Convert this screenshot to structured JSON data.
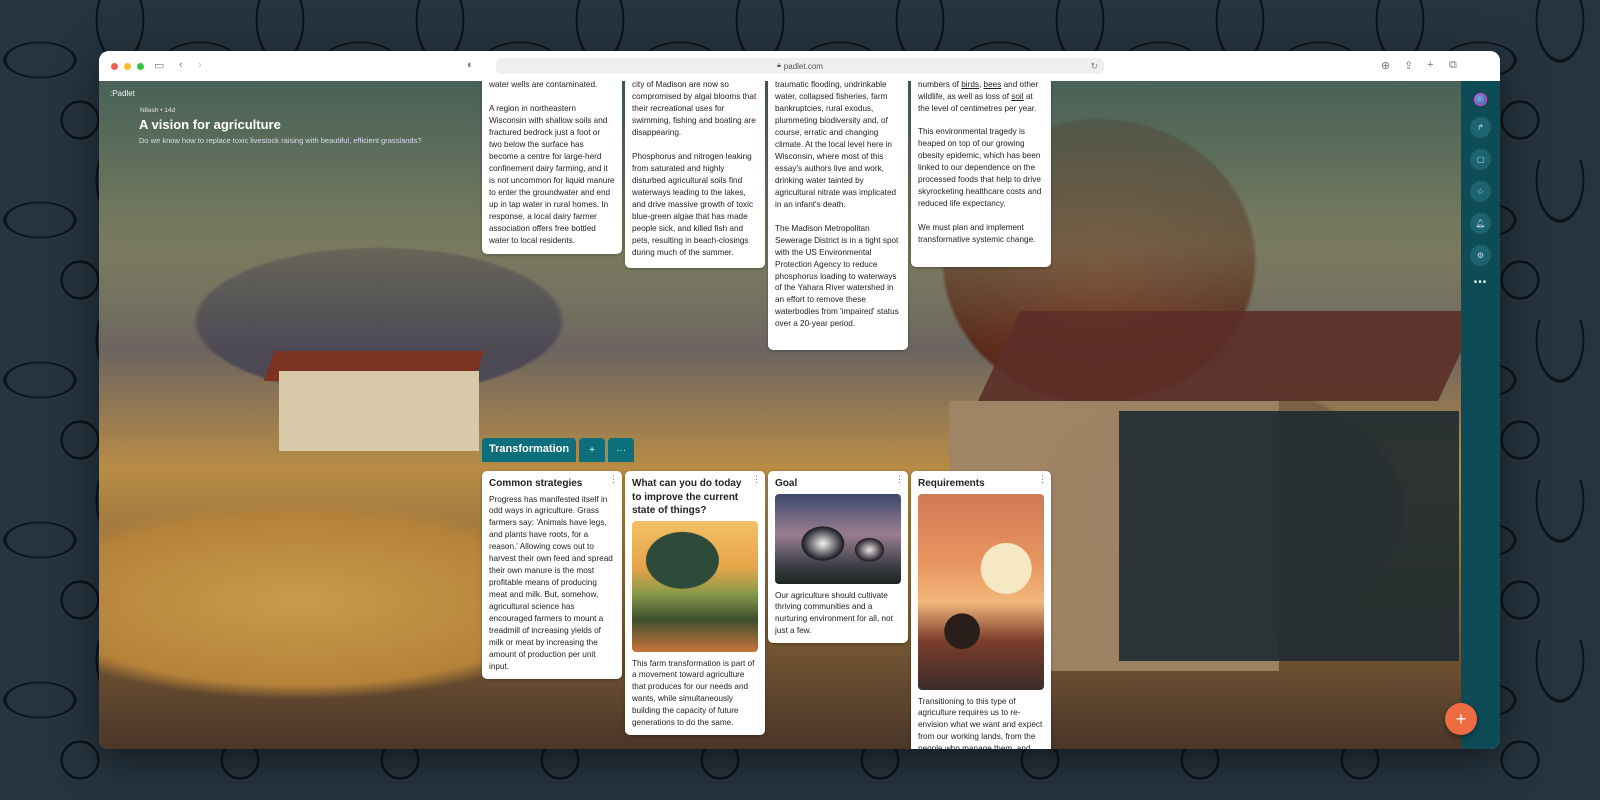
{
  "browser": {
    "url": "padlet.com",
    "icons": {
      "sidebar": "sidebar-icon",
      "back": "chevron-left-icon",
      "forward": "chevron-right-icon",
      "privacy": "shield-icon",
      "download": "download-icon",
      "share": "share-icon",
      "new_tab": "plus-icon",
      "tabs": "tabs-icon",
      "reload": "reload-icon",
      "lock": "lock-icon"
    }
  },
  "header": {
    "brand": ":Padlet",
    "author": "Nitesh",
    "age": "14d",
    "meta": "Nitesh • 14d",
    "title": "A vision for agriculture",
    "description": "Do we know how to replace toxic livestock raising with beautiful, efficient grasslands?"
  },
  "top_cards": [
    {
      "text": "water wells are contaminated.\n\nA region in northeastern Wisconsin with shallow soils and fractured bedrock just a foot or two below the surface has become a centre for large-herd confinement dairy farming, and it is not uncommon for liquid manure to enter the groundwater and end up in tap water in rural homes. In response, a local dairy farmer association offers free bottled water to local residents."
    },
    {
      "text": "city of Madison are now so compromised by algal blooms that their recreational uses for swimming, fishing and boating are disappearing.\n\nPhosphorus and nitrogen leaking from saturated and highly disturbed agricultural soils find waterways leading to the lakes, and drive massive growth of toxic blue-green algae that has made people sick, and killed fish and pets, resulting in beach-closings during much of the summer."
    },
    {
      "text": "traumatic flooding, undrinkable water, collapsed fisheries, farm bankruptcies, rural exodus, plummeting biodiversity and, of course, erratic and changing climate. At the local level here in Wisconsin, where most of this essay's authors live and work, drinking water tainted by agricultural nitrate was implicated in an infant's death.\n\nThe Madison Metropolitan Sewerage District is in a tight spot with the US Environmental Protection Agency to reduce phosphorus loading to waterways of the Yahara River watershed in an effort to remove these waterbodies from 'impaired' status over a 20-year period."
    },
    {
      "text_before": "numbers of ",
      "link1": "birds",
      "sep1": ", ",
      "link2": "bees",
      "mid": " and other wildlife, as well as loss of ",
      "link3": "soil",
      "after": " at the level of centimetres per year.",
      "text": "This environmental tragedy is heaped on top of our growing obesity epidemic, which has been linked to our dependence on the processed foods that help to drive skyrocketing healthcare costs and reduced life expectancy.\n\nWe must plan and implement transformative systemic change."
    }
  ],
  "section": {
    "title": "Transformation",
    "add_label": "+",
    "more_label": "···"
  },
  "cards": [
    {
      "title": "Common strategies",
      "body": "Progress has manifested itself in odd ways in agriculture. Grass farmers say: 'Animals have legs, and plants have roots, for a reason.' Allowing cows out to harvest their own feed and spread their own manure is the most profitable means of producing meat and milk. But, somehow, agricultural science has encouraged farmers to mount a treadmill of increasing yields of milk or meat by increasing the amount of production per unit input."
    },
    {
      "title": "What can you do today to improve the current state of things?",
      "image": "winding-road-landscape",
      "body": "This farm transformation is part of a movement toward agriculture that produces for our needs and wants, while simultaneously building the capacity of future generations to do the same."
    },
    {
      "title": "Goal",
      "image": "cows-in-field",
      "body": "Our agriculture should cultivate thriving communities and a nurturing environment for all, not just a few."
    },
    {
      "title": "Requirements",
      "image": "tractor-at-sunset",
      "body": "Transitioning to this type of agriculture requires us to re-envision what we want and expect from our working lands, from the people who manage them, and from the landscapes in which they are embedded."
    }
  ],
  "card_menu_label": "⋮",
  "right_rail": {
    "items": [
      "avatar",
      "share-icon",
      "slideshow-icon",
      "star-icon",
      "bell-icon",
      "gear-icon"
    ],
    "more": "•••"
  },
  "fab_label": "+",
  "colors": {
    "section": "#0e6f7c",
    "rail": "#0d4b57",
    "fab": "#ef6b41"
  }
}
